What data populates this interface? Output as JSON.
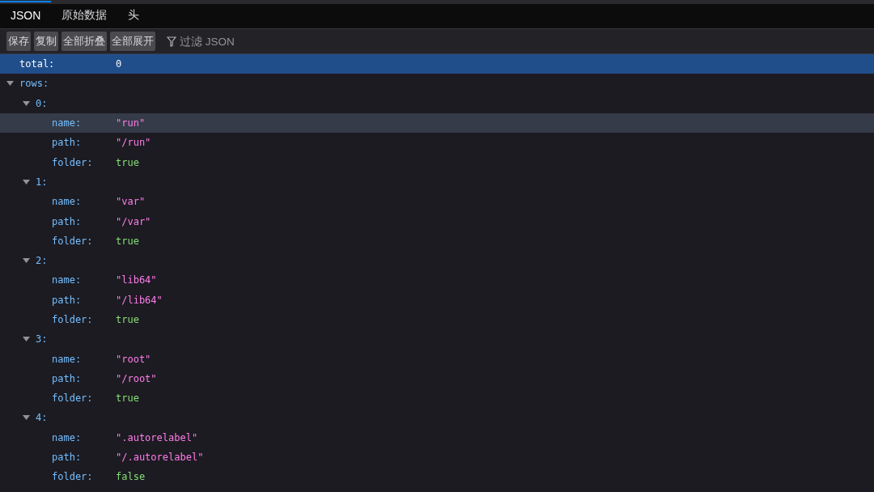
{
  "tabs": [
    {
      "label": "JSON",
      "selected": true
    },
    {
      "label": "原始数据",
      "selected": false
    },
    {
      "label": "头",
      "selected": false
    }
  ],
  "toolbar": {
    "buttons": [
      "保存",
      "复制",
      "全部折叠",
      "全部展开"
    ],
    "filter": {
      "placeholder": "过滤 JSON"
    }
  },
  "tree": [
    {
      "key": "total:",
      "value": "0",
      "kind": "number",
      "selected": true,
      "hovered": false
    },
    {
      "key": "rows:",
      "expanded": true,
      "selected": false,
      "hovered": false,
      "children": [
        {
          "key": "0:",
          "expanded": true,
          "selected": false,
          "hovered": false,
          "children": [
            {
              "key": "name:",
              "value": "\"run\"",
              "kind": "string",
              "selected": false,
              "hovered": true
            },
            {
              "key": "path:",
              "value": "\"/run\"",
              "kind": "string",
              "selected": false,
              "hovered": false
            },
            {
              "key": "folder:",
              "value": "true",
              "kind": "boolean",
              "selected": false,
              "hovered": false
            }
          ]
        },
        {
          "key": "1:",
          "expanded": true,
          "selected": false,
          "hovered": false,
          "children": [
            {
              "key": "name:",
              "value": "\"var\"",
              "kind": "string",
              "selected": false,
              "hovered": false
            },
            {
              "key": "path:",
              "value": "\"/var\"",
              "kind": "string",
              "selected": false,
              "hovered": false
            },
            {
              "key": "folder:",
              "value": "true",
              "kind": "boolean",
              "selected": false,
              "hovered": false
            }
          ]
        },
        {
          "key": "2:",
          "expanded": true,
          "selected": false,
          "hovered": false,
          "children": [
            {
              "key": "name:",
              "value": "\"lib64\"",
              "kind": "string",
              "selected": false,
              "hovered": false
            },
            {
              "key": "path:",
              "value": "\"/lib64\"",
              "kind": "string",
              "selected": false,
              "hovered": false
            },
            {
              "key": "folder:",
              "value": "true",
              "kind": "boolean",
              "selected": false,
              "hovered": false
            }
          ]
        },
        {
          "key": "3:",
          "expanded": true,
          "selected": false,
          "hovered": false,
          "children": [
            {
              "key": "name:",
              "value": "\"root\"",
              "kind": "string",
              "selected": false,
              "hovered": false
            },
            {
              "key": "path:",
              "value": "\"/root\"",
              "kind": "string",
              "selected": false,
              "hovered": false
            },
            {
              "key": "folder:",
              "value": "true",
              "kind": "boolean",
              "selected": false,
              "hovered": false
            }
          ]
        },
        {
          "key": "4:",
          "expanded": true,
          "selected": false,
          "hovered": false,
          "children": [
            {
              "key": "name:",
              "value": "\".autorelabel\"",
              "kind": "string",
              "selected": false,
              "hovered": false
            },
            {
              "key": "path:",
              "value": "\"/.autorelabel\"",
              "kind": "string",
              "selected": false,
              "hovered": false
            },
            {
              "key": "folder:",
              "value": "false",
              "kind": "boolean",
              "selected": false,
              "hovered": false
            }
          ]
        }
      ]
    }
  ]
}
